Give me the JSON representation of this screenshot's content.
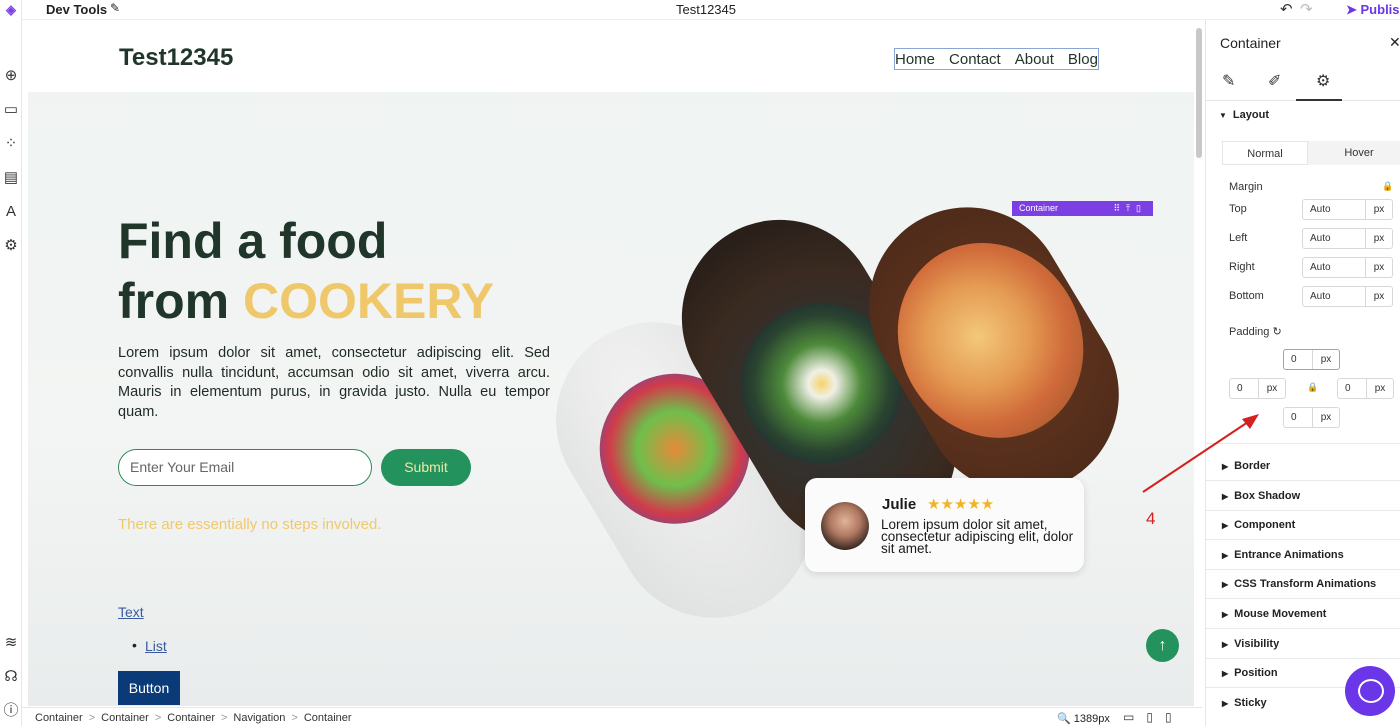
{
  "app": {
    "name": "Dev Tools",
    "page_title": "Test12345",
    "publish_label": "Publish"
  },
  "site": {
    "brand": "Test12345",
    "nav": [
      "Home",
      "Contact",
      "About",
      "Blog"
    ],
    "hero_title_line1": "Find a food",
    "hero_title_from": "from",
    "hero_title_accent": "COOKERY",
    "hero_desc": "Lorem ipsum dolor sit amet, consectetur adipiscing elit. Sed convallis nulla tincidunt, accumsan odio sit amet, viverra arcu. Mauris in elementum purus, in gravida justo. Nulla eu tempor quam.",
    "email_placeholder": "Enter Your Email",
    "submit_label": "Submit",
    "note": "There are essentially no steps involved.",
    "text_link": "Text",
    "list_item": "List",
    "button_label": "Button",
    "selection_badge": "Container",
    "review": {
      "name": "Julie",
      "stars": "★★★★★",
      "text": "Lorem ipsum dolor sit amet, consectetur adipiscing elit, dolor sit amet."
    }
  },
  "bottombar": {
    "breadcrumbs": [
      "Container",
      "Container",
      "Container",
      "Navigation",
      "Container"
    ],
    "zoom": "1389px"
  },
  "panel": {
    "title": "Container",
    "section_layout": "Layout",
    "state_tabs": [
      "Normal",
      "Hover"
    ],
    "margin_label": "Margin",
    "margin_rows": [
      {
        "label": "Top",
        "value": "Auto",
        "unit": "px"
      },
      {
        "label": "Left",
        "value": "Auto",
        "unit": "px"
      },
      {
        "label": "Right",
        "value": "Auto",
        "unit": "px"
      },
      {
        "label": "Bottom",
        "value": "Auto",
        "unit": "px"
      }
    ],
    "padding_label": "Padding",
    "padding": {
      "top": "0",
      "left": "0",
      "right": "0",
      "bottom": "0",
      "unit": "px"
    },
    "sections": [
      "Border",
      "Box Shadow",
      "Component",
      "Entrance Animations",
      "CSS Transform Animations",
      "Mouse Movement",
      "Visibility",
      "Position",
      "Sticky"
    ]
  },
  "annotation": {
    "number": "4",
    "color": "#d42020"
  },
  "colors": {
    "brand_purple": "#6b35e8",
    "green": "#23925c",
    "gold": "#f0c86c",
    "dark_green": "#21362b"
  }
}
